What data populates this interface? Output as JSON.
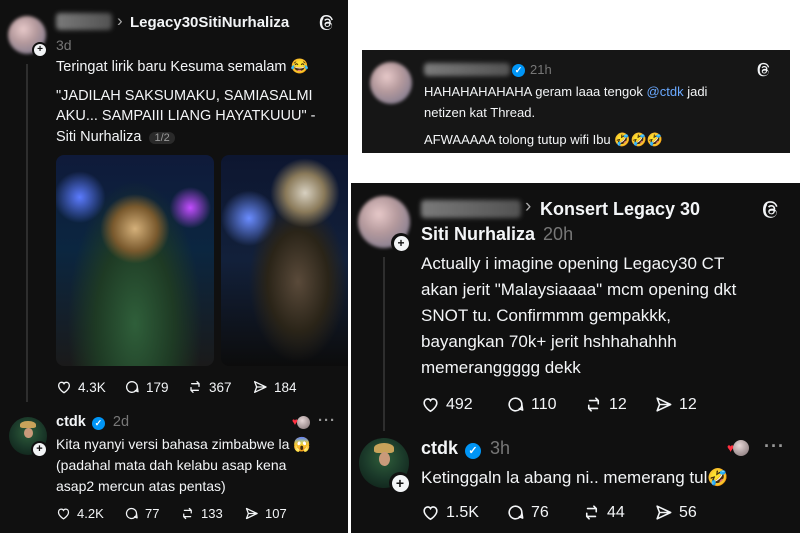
{
  "colors": {
    "bg": "#101010",
    "text": "#f3f5f7",
    "muted": "#777777",
    "link": "#0095f6",
    "heart": "#ff3040"
  },
  "panel1": {
    "breadcrumb_arrow": "›",
    "topic": "Legacy30SitiNurhaliza",
    "time": "3d",
    "post_line1": "Teringat lirik baru Kesuma semalam 😂",
    "post_line2": "\"JADILAH SAKSUMAKU, SAMIASALMI",
    "post_line3": "AKU... SAMPAIII LIANG HAYATKUUU\" -",
    "post_line4": "Siti Nurhaliza",
    "pager": "1/2",
    "stats": {
      "likes": "4.3K",
      "replies": "179",
      "reposts": "367",
      "shares": "184"
    },
    "reply": {
      "username": "ctdk",
      "time": "2d",
      "line1": "Kita nyanyi versi bahasa zimbabwe la 😱",
      "line2": "(padahal mata dah kelabu asap kena",
      "line3": "asap2 mercun atas pentas)",
      "stats": {
        "likes": "4.2K",
        "replies": "77",
        "reposts": "133",
        "shares": "107"
      },
      "dots": "···"
    }
  },
  "panel2": {
    "time": "21h",
    "line1_pre": "HAHAHAHAHAHA geram laaa tengok ",
    "mention": "@ctdk",
    "line1_post": " jadi",
    "line2": "netizen kat Thread.",
    "line3": "AFWAAAAA tolong tutup wifi Ibu 🤣🤣🤣"
  },
  "panel3": {
    "breadcrumb_arrow": "›",
    "topic_line1": "Konsert Legacy 30",
    "topic_line2": "Siti Nurhaliza",
    "time": "20h",
    "line1": "Actually i imagine opening Legacy30 CT",
    "line2": "akan jerit \"Malaysiaaaa\" mcm opening dkt",
    "line3": "SNOT tu. Confirmmm gempakkk,",
    "line4": "bayangkan 70k+ jerit hshhahahhh",
    "line5": "memeranggggg dekk",
    "stats": {
      "likes": "492",
      "replies": "110",
      "reposts": "12",
      "shares": "12"
    },
    "reply": {
      "username": "ctdk",
      "time": "3h",
      "line1": "Ketinggaln la abang ni.. memerang tul🤣",
      "stats": {
        "likes": "1.5K",
        "replies": "76",
        "reposts": "44",
        "shares": "56"
      },
      "dots": "···"
    }
  }
}
